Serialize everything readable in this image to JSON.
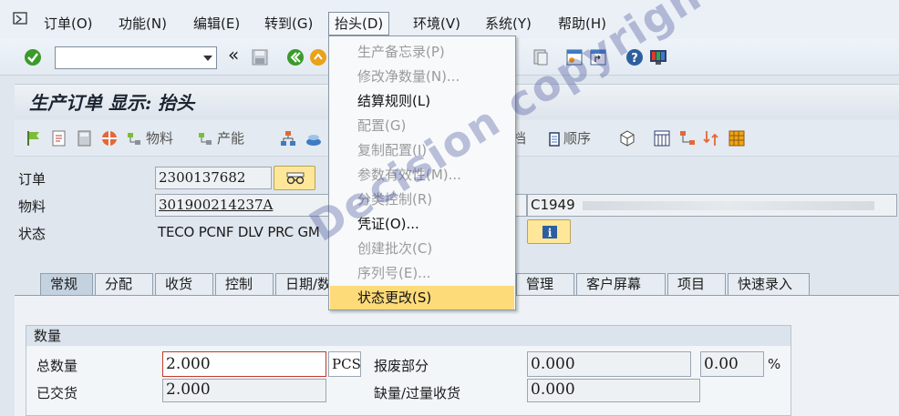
{
  "menubar": {
    "items": [
      "订单(O)",
      "功能(N)",
      "编辑(E)",
      "转到(G)",
      "抬头(D)",
      "环境(V)",
      "系统(Y)",
      "帮助(H)"
    ],
    "active_index": 4
  },
  "toolbar": {
    "command_value": "",
    "back_glyph": "«"
  },
  "title": "生产订单 显示: 抬头",
  "app_toolbar": {
    "material_label": "物料",
    "capacity_label": "产能",
    "sequence_label": "顺序",
    "truncated_label": "档"
  },
  "header": {
    "order_label": "订单",
    "order_value": "2300137682",
    "material_label": "物料",
    "material_value": "301900214237A",
    "material_desc_value": "C1949",
    "status_label": "状态",
    "status_value": "TECO PCNF DLV  PRC  GM"
  },
  "tabs": [
    {
      "label": "常规",
      "active": true
    },
    {
      "label": "分配",
      "active": false
    },
    {
      "label": "收货",
      "active": false
    },
    {
      "label": "控制",
      "active": false
    },
    {
      "label": "日期/数",
      "active": false
    },
    {
      "label": "管理",
      "active": false
    },
    {
      "label": "客户屏幕",
      "active": false
    },
    {
      "label": "项目",
      "active": false
    },
    {
      "label": "快速录入",
      "active": false
    }
  ],
  "quantity_group": {
    "title": "数量",
    "total_label": "总数量",
    "total_value": "2.000",
    "unit": "PCS",
    "scrap_label": "报废部分",
    "scrap_value": "0.000",
    "scrap_pct_value": "0.00",
    "pct_symbol": "%",
    "delivered_label": "已交货",
    "delivered_value": "2.000",
    "shortage_label": "缺量/过量收货",
    "shortage_value": "0.000"
  },
  "dropdown": {
    "items": [
      {
        "label": "生产备忘录(P)",
        "enabled": false
      },
      {
        "label": "修改净数量(N)...",
        "enabled": false
      },
      {
        "label": "结算规则(L)",
        "enabled": true
      },
      {
        "label": "配置(G)",
        "enabled": false
      },
      {
        "label": "复制配置(I)",
        "enabled": false
      },
      {
        "label": "参数有效性(M)...",
        "enabled": false
      },
      {
        "label": "分类控制(R)",
        "enabled": false
      },
      {
        "label": "凭证(O)...",
        "enabled": true
      },
      {
        "label": "创建批次(C)",
        "enabled": false
      },
      {
        "label": "序列号(E)...",
        "enabled": false
      },
      {
        "label": "状态更改(S)",
        "enabled": true,
        "highlight": true
      }
    ]
  },
  "watermark": "Decision copyright",
  "colors": {
    "highlight": "#fddb79",
    "check_green": "#3a9b2a",
    "background": "#dfe6ee"
  }
}
